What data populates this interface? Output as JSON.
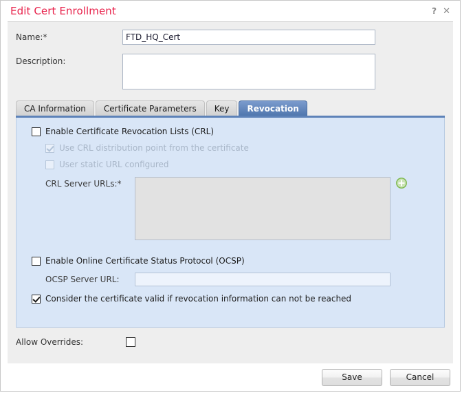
{
  "window": {
    "title": "Edit Cert Enrollment",
    "help_icon": "?",
    "close_icon": "✕"
  },
  "form": {
    "name_label": "Name:*",
    "name_value": "FTD_HQ_Cert",
    "description_label": "Description:",
    "description_value": ""
  },
  "tabs": [
    {
      "label": "CA Information",
      "active": false
    },
    {
      "label": "Certificate Parameters",
      "active": false
    },
    {
      "label": "Key",
      "active": false
    },
    {
      "label": "Revocation",
      "active": true
    }
  ],
  "revocation": {
    "enable_crl": {
      "label": "Enable Certificate Revocation Lists (CRL)",
      "checked": false,
      "disabled": false
    },
    "use_crl_distribution_point": {
      "label": "Use CRL distribution point from the certificate",
      "checked": true,
      "disabled": true
    },
    "user_static_url": {
      "label": "User static URL configured",
      "checked": false,
      "disabled": true
    },
    "crl_server_urls_label": "CRL Server URLs:*",
    "crl_server_urls_value": "",
    "add_icon": "add-icon",
    "enable_ocsp": {
      "label": "Enable Online Certificate Status Protocol (OCSP)",
      "checked": false,
      "disabled": false
    },
    "ocsp_server_url_label": "OCSP Server URL:",
    "ocsp_server_url_value": "",
    "consider_valid": {
      "label": "Consider the certificate valid if revocation information can not be reached",
      "checked": true,
      "disabled": false
    }
  },
  "overrides": {
    "label": "Allow Overrides:",
    "checked": false
  },
  "footer": {
    "save_label": "Save",
    "cancel_label": "Cancel"
  },
  "colors": {
    "title": "#e8224b",
    "active_tab": "#5077ae",
    "panel_bg": "#d9e6f7",
    "body_bg": "#eeeeee",
    "add_icon": "#7ab648"
  }
}
